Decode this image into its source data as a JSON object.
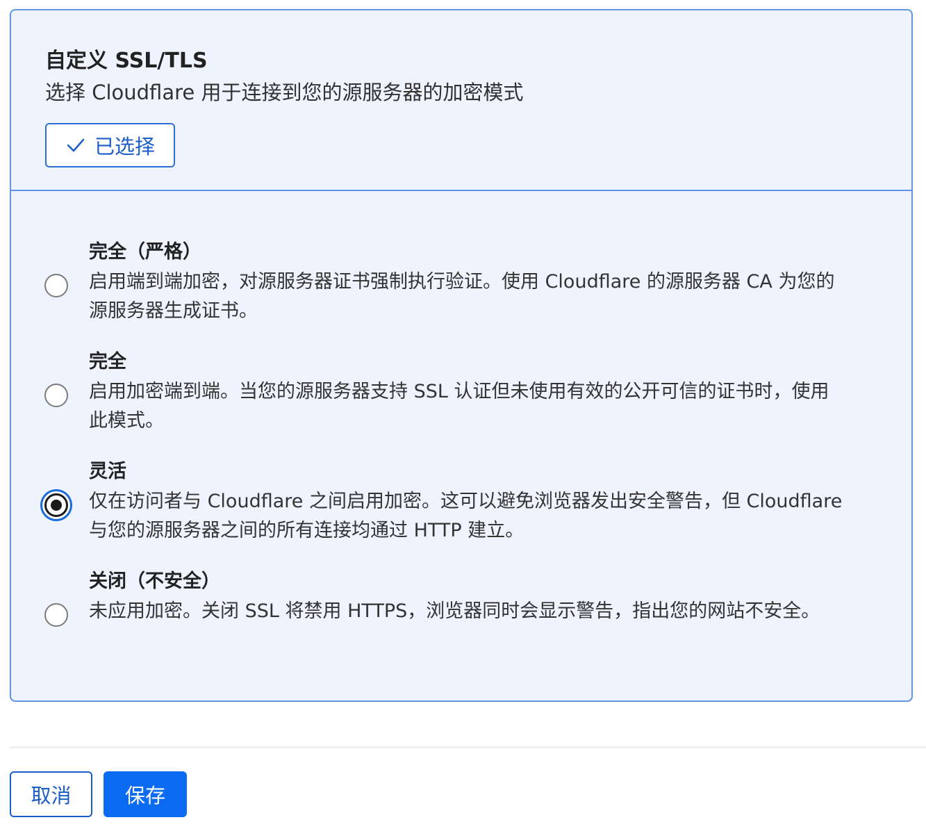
{
  "card": {
    "title": "自定义 SSL/TLS",
    "subtitle": "选择 Cloudflare 用于连接到您的源服务器的加密模式",
    "selected_label": "已选择"
  },
  "options": [
    {
      "title": "完全（严格）",
      "desc_line1": "启用端到端加密，对源服务器证书强制执行验证。使用 Cloudflare 的源服务器 CA 为您的",
      "desc_line2": "源服务器生成证书。",
      "checked": false
    },
    {
      "title": "完全",
      "desc_line1": "启用加密端到端。当您的源服务器支持 SSL 认证但未使用有效的公开可信的证书时，使用",
      "desc_line2": "此模式。",
      "checked": false
    },
    {
      "title": "灵活",
      "desc_line1": "仅在访问者与 Cloudflare 之间启用加密。这可以避免浏览器发出安全警告，但 Cloudflare",
      "desc_line2": "与您的源服务器之间的所有连接均通过 HTTP 建立。",
      "checked": true
    },
    {
      "title": "关闭（不安全）",
      "desc_line1": "未应用加密。关闭 SSL 将禁用 HTTPS，浏览器同时会显示警告，指出您的网站不安全。",
      "checked": false
    }
  ],
  "footer": {
    "cancel_label": "取消",
    "save_label": "保存"
  },
  "colors": {
    "accent": "#0b6cf3",
    "card_border": "#5f93e3",
    "card_bg": "#eef3fd"
  }
}
